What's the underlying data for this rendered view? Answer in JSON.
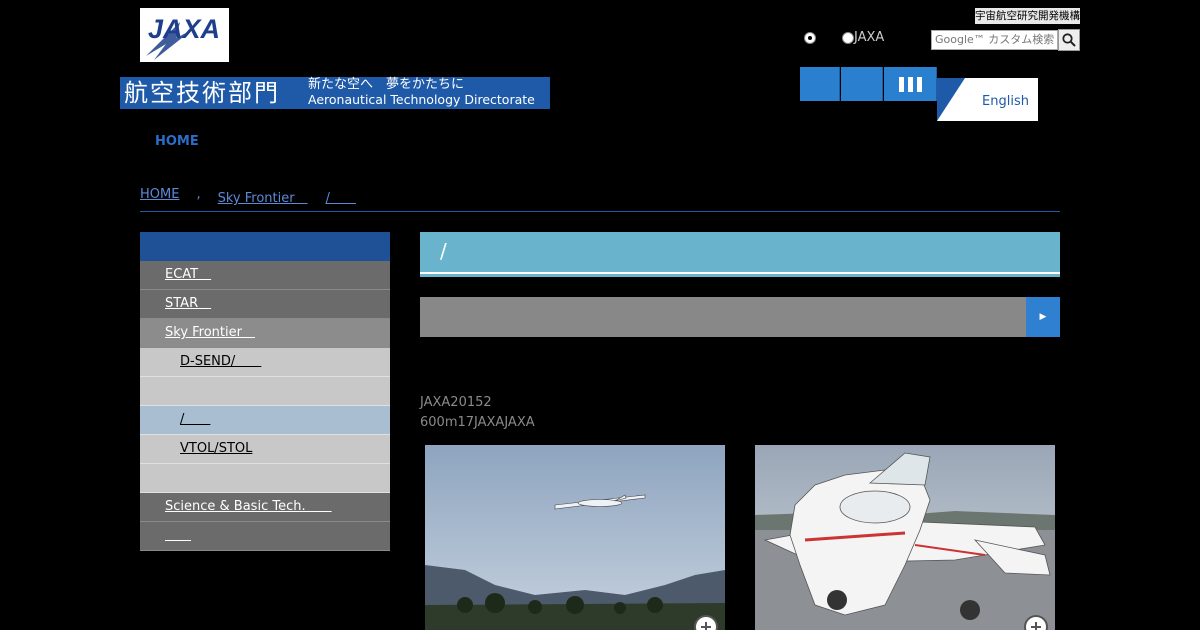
{
  "header": {
    "logo": "JAXA",
    "dept_title_jp": "航空技術部門",
    "dept_subtitle": "新たな空へ　夢をかたちに",
    "dept_title_en": "Aeronautical Technology Directorate",
    "org_label": "宇宙航空研究開発機構",
    "radio_option_2": "JAXA",
    "search_placeholder": "Google™ カスタム検索",
    "english_label": "English"
  },
  "global_nav": {
    "home": "HOME"
  },
  "breadcrumb": {
    "home": "HOME",
    "sep": ",",
    "item2": "Sky Frontier　",
    "item3": "/　　"
  },
  "sidebar": {
    "items": [
      {
        "label": "ECAT　",
        "level": 1
      },
      {
        "label": "STAR　",
        "level": 1
      },
      {
        "label": "Sky Frontier　",
        "level": 1
      },
      {
        "label": "D-SEND/　　",
        "level": 2
      },
      {
        "label": "",
        "level": 2
      },
      {
        "label": "/　　",
        "level": 2
      },
      {
        "label": "VTOL/STOL",
        "level": 2
      },
      {
        "label": "",
        "level": 2
      },
      {
        "label": "Science & Basic Tech.　　",
        "level": 1
      },
      {
        "label": "　　",
        "level": 1
      }
    ]
  },
  "main": {
    "page_title": "/",
    "dropdown_arrow": "▶",
    "text_line1": "JAXA20152",
    "text_line2": "600m17JAXAJAXA"
  },
  "icons": [
    "search-icon",
    "zoom-icon",
    "menu-bars-icon"
  ],
  "colors": {
    "brand_blue": "#1e5aa8",
    "heading_teal": "#6ab3cd",
    "button_blue": "#2f80d0"
  }
}
